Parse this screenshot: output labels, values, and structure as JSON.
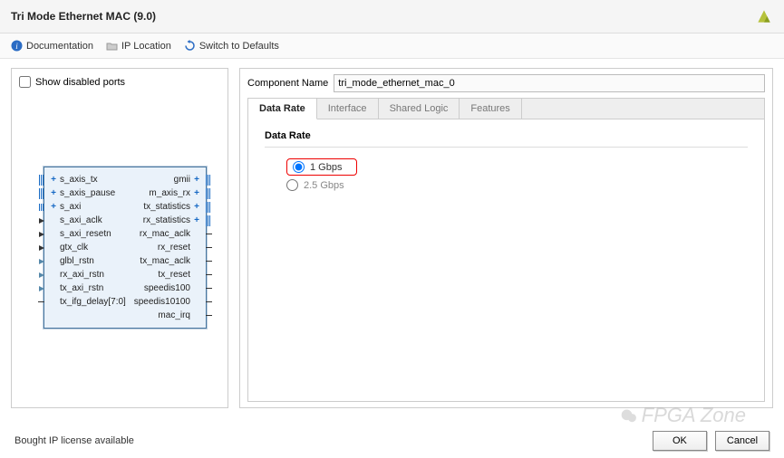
{
  "title": "Tri Mode Ethernet MAC (9.0)",
  "toolbar": {
    "documentation": "Documentation",
    "ip_location": "IP Location",
    "switch_defaults": "Switch to Defaults"
  },
  "left": {
    "show_disabled_label": "Show disabled ports",
    "block": {
      "left_ports": [
        "s_axis_tx",
        "s_axis_pause",
        "s_axi",
        "s_axi_aclk",
        "s_axi_resetn",
        "gtx_clk",
        "glbl_rstn",
        "rx_axi_rstn",
        "tx_axi_rstn",
        "tx_ifg_delay[7:0]"
      ],
      "right_ports": [
        "gmii",
        "m_axis_rx",
        "tx_statistics",
        "rx_statistics",
        "rx_mac_aclk",
        "rx_reset",
        "tx_mac_aclk",
        "tx_reset",
        "speedis100",
        "speedis10100",
        "mac_irq"
      ]
    }
  },
  "right": {
    "component_name_label": "Component Name",
    "component_name_value": "tri_mode_ethernet_mac_0",
    "tabs": [
      "Data Rate",
      "Interface",
      "Shared Logic",
      "Features"
    ],
    "section_title": "Data Rate",
    "options": [
      {
        "label": "1 Gbps",
        "selected": true,
        "highlight": true
      },
      {
        "label": "2.5 Gbps",
        "selected": false,
        "highlight": false
      }
    ]
  },
  "footer": {
    "license_text": "Bought IP license available",
    "ok_label": "OK",
    "cancel_label": "Cancel"
  },
  "watermark": "FPGA Zone"
}
